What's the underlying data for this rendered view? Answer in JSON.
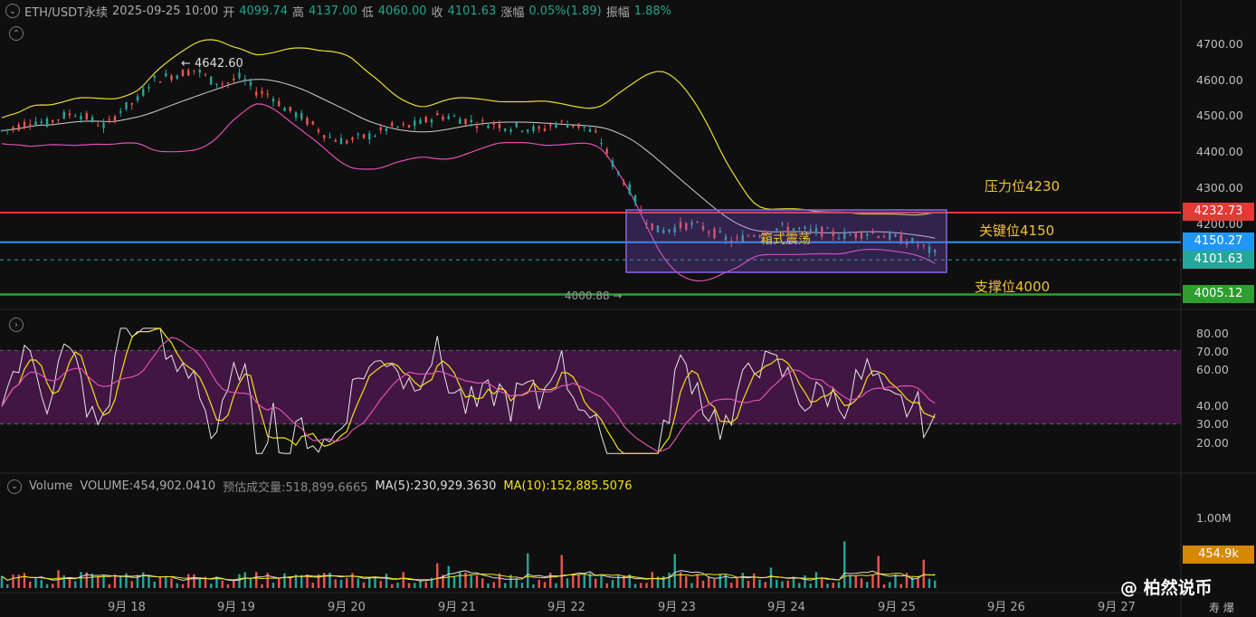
{
  "header": {
    "symbol": "ETH/USDT永续",
    "time": "2025-09-25 10:00",
    "open_label": "开",
    "open": "4099.74",
    "high_label": "高",
    "high": "4137.00",
    "low_label": "低",
    "low": "4060.00",
    "close_label": "收",
    "close": "4101.63",
    "change_label": "涨幅",
    "change": "0.05%(1.89)",
    "amplitude_label": "振幅",
    "amplitude": "1.88%"
  },
  "price_axis": [
    "4700.00",
    "4600.00",
    "4500.00",
    "4400.00",
    "4300.00",
    "4200.00"
  ],
  "price_tags": {
    "resistance": {
      "value": "4232.73",
      "color": "#e53935"
    },
    "key": {
      "value": "4150.27",
      "color": "#2196f3"
    },
    "last": {
      "value": "4101.63",
      "color": "#26a69a"
    },
    "support": {
      "value": "4005.12",
      "color": "#2e9e2e"
    }
  },
  "annotations": {
    "resistance": "压力位4230",
    "key": "关键位4150",
    "support": "支撑位4000",
    "box": "箱式震荡",
    "high_marker": "← 4642.60",
    "low_marker": "4000.88 →"
  },
  "rsi_axis": [
    "80.00",
    "70.00",
    "60.00",
    "40.00",
    "30.00",
    "20.00"
  ],
  "volume": {
    "title": "Volume",
    "value": "VOLUME:454,902.0410",
    "estimate": "预估成交量:518,899.6665",
    "ma5": "MA(5):230,929.3630",
    "ma10": "MA(10):152,885.5076",
    "axis_top": "1.00M",
    "tag": "454.9k"
  },
  "dates": [
    "9月 18",
    "9月 19",
    "9月 20",
    "9月 21",
    "9月 22",
    "9月 23",
    "9月 24",
    "9月 25",
    "9月 26",
    "9月 27"
  ],
  "watermark": "@ 柏然说币",
  "corner_text": "寿 爆",
  "chart_data": {
    "type": "candlestick",
    "symbol": "ETH/USDT",
    "price_range": [
      3990,
      4740
    ],
    "ohlc_last": {
      "open": 4099.74,
      "high": 4137.0,
      "low": 4060.0,
      "close": 4101.63
    },
    "levels": {
      "resistance": 4232.73,
      "key": 4150.27,
      "last": 4101.63,
      "support": 4005.12
    },
    "close_series": [
      4460,
      4470,
      4490,
      4480,
      4500,
      4510,
      4490,
      4470,
      4520,
      4540,
      4600,
      4610,
      4620,
      4630,
      4600,
      4590,
      4610,
      4570,
      4560,
      4520,
      4500,
      4470,
      4440,
      4430,
      4440,
      4450,
      4470,
      4470,
      4480,
      4500,
      4500,
      4490,
      4480,
      4480,
      4470,
      4470,
      4460,
      4480,
      4480,
      4470,
      4440,
      4360,
      4300,
      4220,
      4180,
      4190,
      4200,
      4190,
      4170,
      4150,
      4170,
      4180,
      4190,
      4190,
      4180,
      4180,
      4170,
      4170,
      4180,
      4170,
      4160,
      4150,
      4130,
      4101.63
    ],
    "rsi_overbought": 70,
    "rsi_oversold": 30,
    "rsi_last": 33
  }
}
